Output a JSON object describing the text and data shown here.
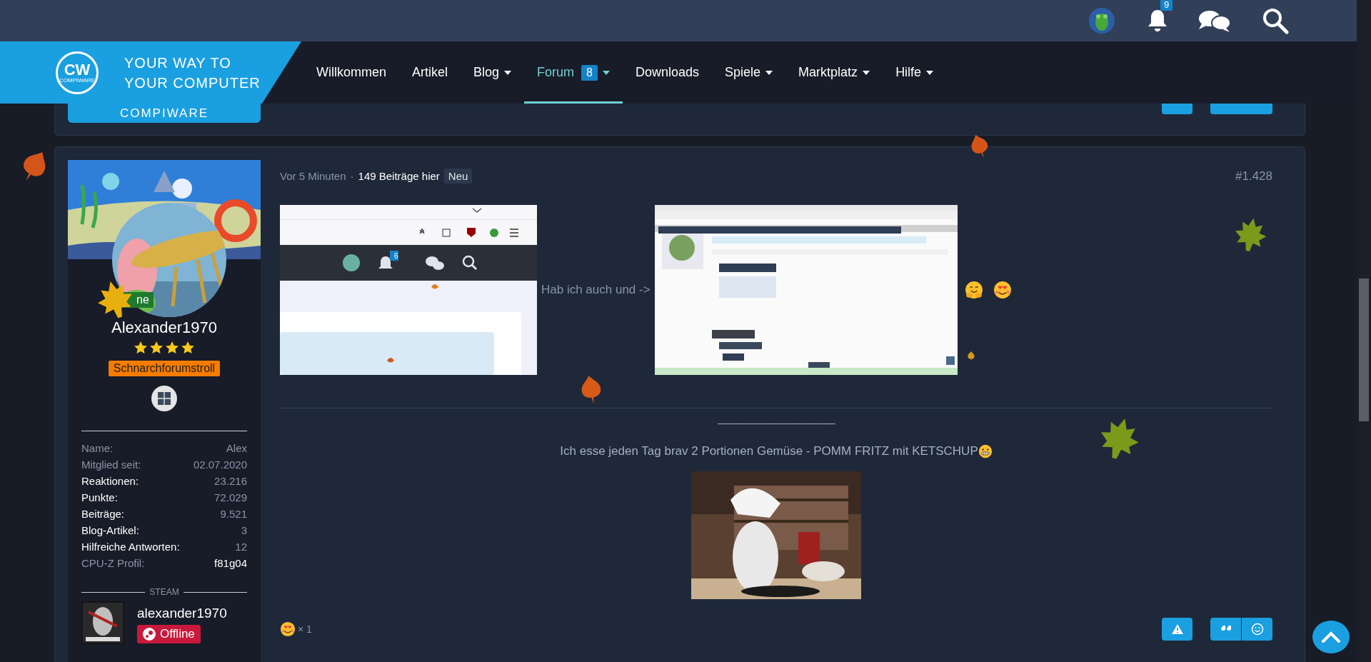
{
  "top_bar": {
    "notifications": "9"
  },
  "nav": {
    "logo": {
      "mark": "CW",
      "mark_small": "COMPIWARE",
      "line_1": "YOUR WAY TO",
      "line_2": "YOUR COMPUTER",
      "caption": "COMPIWARE"
    },
    "items": [
      {
        "label": "Willkommen",
        "selected": false,
        "dropdown": false
      },
      {
        "label": "Artikel",
        "selected": false,
        "dropdown": false
      },
      {
        "label": "Blog",
        "selected": false,
        "dropdown": true
      },
      {
        "label": "Forum",
        "selected": true,
        "dropdown": true,
        "badge": "8"
      },
      {
        "label": "Downloads",
        "selected": false,
        "dropdown": false
      },
      {
        "label": "Spiele",
        "selected": false,
        "dropdown": true
      },
      {
        "label": "Marktplatz",
        "selected": false,
        "dropdown": true
      },
      {
        "label": "Hilfe",
        "selected": false,
        "dropdown": true
      }
    ]
  },
  "post": {
    "author": {
      "status": "ne",
      "name": "Alexander1970",
      "stars": 4,
      "title": "Schnarchforumstroll",
      "stats": [
        {
          "label": "Name:",
          "value": "Alex",
          "kind": "muted"
        },
        {
          "label": "Mitglied seit:",
          "value": "02.07.2020",
          "kind": "muted"
        },
        {
          "label": "Reaktionen:",
          "value": "23.216",
          "kind": "bold"
        },
        {
          "label": "Punkte:",
          "value": "72.029",
          "kind": "bold"
        },
        {
          "label": "Beiträge:",
          "value": "9.521",
          "kind": "bold"
        },
        {
          "label": "Blog-Artikel:",
          "value": "3",
          "kind": "bold"
        },
        {
          "label": "Hilfreiche Antworten:",
          "value": "12",
          "kind": "bold"
        },
        {
          "label": "CPU-Z Profil:",
          "value": "f81g04",
          "kind": "custom"
        }
      ],
      "steam": {
        "heading": "STEAM",
        "name": "alexander1970",
        "status": "Offline"
      }
    },
    "time": "Vor 5 Minuten",
    "separator": "·",
    "posts_here": "149 Beiträge hier",
    "new_label": "Neu",
    "number": "#1.428",
    "screenshot_badge": "6",
    "inline_text": "Hab ich auch und ->",
    "divider": "-------------------------------------------------------",
    "signature": "Ich esse jeden Tag brav 2 Portionen Gemüse - POMM FRITZ mit KETSCHUP",
    "reaction_count": "× 1"
  }
}
